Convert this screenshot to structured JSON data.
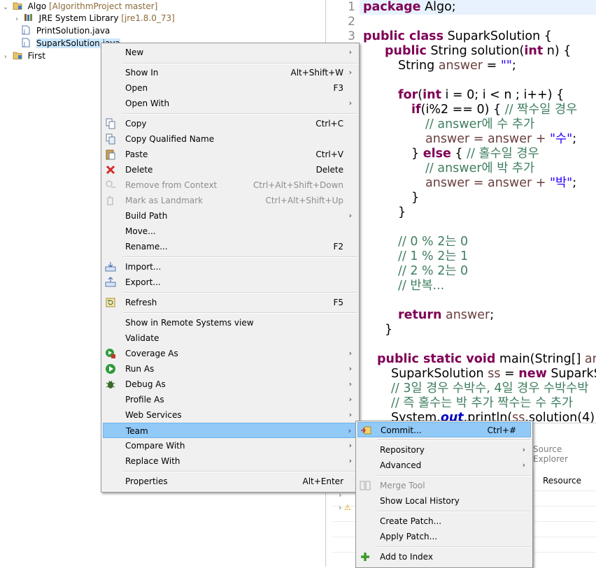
{
  "explorer": {
    "rows": [
      {
        "label": "Algo",
        "decoration": "[AlgorithmProject master]"
      },
      {
        "label": "JRE System Library",
        "decoration": "[jre1.8.0_73]"
      },
      {
        "label": "PrintSolution.java"
      },
      {
        "label": "SuparkSolution.java"
      },
      {
        "label": "First"
      }
    ]
  },
  "editor": {
    "line_numbers": [
      "1",
      "2",
      "3"
    ],
    "lines": {
      "l1_kw": "package",
      "l1_rest": " Algo;",
      "l3_kw": "public class",
      "l3_rest": " SuparkSolution {",
      "l4_kw": "public",
      "l4_a": " String solution(",
      "l4_kw2": "int",
      "l4_b": " n) {",
      "l5_a": "String ",
      "l5_var": "answer",
      "l5_b": " = ",
      "l5_str": "\"\"",
      "l5_c": ";",
      "l7_kw": "for",
      "l7_a": "(",
      "l7_kw2": "int",
      "l7_b": " i = 0; i < n ; i++) {",
      "l8_kw": "if",
      "l8_a": "(i%2 == 0) { ",
      "l8_cm": "// 짝수일 경우",
      "l9_cm": "// answer에 수 추가",
      "l10_a": "answer = answer + ",
      "l10_str": "\"수\"",
      "l10_b": ";",
      "l11_a": "} ",
      "l11_kw": "else",
      "l11_b": " { ",
      "l11_cm": "// 홀수일 경우",
      "l12_cm": "// answer에 박 추가",
      "l13_a": "answer = answer + ",
      "l13_str": "\"박\"",
      "l13_b": ";",
      "l14": "}",
      "l15": "}",
      "l17_cm": "// 0 % 2는 0",
      "l18_cm": "// 1 % 2는 1",
      "l19_cm": "// 2 % 2는 0",
      "l20_cm": "// 반복...",
      "l22_kw": "return",
      "l22_var": " answer",
      "l22_b": ";",
      "l23": "}",
      "l25_kw": "public static void",
      "l25_a": " main(String[] ",
      "l25_var": "args",
      "l26_a": "SuparkSolution ",
      "l26_var": "ss",
      "l26_b": " = ",
      "l26_kw": "new",
      "l26_c": " SuparkS",
      "l27_cm": "// 3일 경우 수박수, 4일 경우 수박수박",
      "l28_cm": "// 즉 홀수는 박 추가 짝수는 수 추가",
      "l29_a": "System.",
      "l29_it": "out",
      "l29_b": ".println(",
      "l29_var": "ss",
      "l29_c": ".solution(4)"
    }
  },
  "bottom_panel": {
    "tab_source_explorer": "Source Explorer",
    "column_resource": "Resource"
  },
  "context_menu": {
    "items": [
      {
        "label": "New",
        "arrow": "›"
      },
      {
        "label": "Show In",
        "accel": "Alt+Shift+W",
        "arrow": "›"
      },
      {
        "label": "Open",
        "accel": "F3"
      },
      {
        "label": "Open With",
        "arrow": "›"
      },
      {
        "label": "Copy",
        "accel": "Ctrl+C",
        "icon": "copy-icon"
      },
      {
        "label": "Copy Qualified Name",
        "icon": "copy-qualified-icon"
      },
      {
        "label": "Paste",
        "accel": "Ctrl+V",
        "icon": "paste-icon"
      },
      {
        "label": "Delete",
        "accel": "Delete",
        "icon": "delete-icon"
      },
      {
        "label": "Remove from Context",
        "accel": "Ctrl+Alt+Shift+Down",
        "icon": "remove-context-icon",
        "disabled": true
      },
      {
        "label": "Mark as Landmark",
        "accel": "Ctrl+Alt+Shift+Up",
        "icon": "landmark-icon",
        "disabled": true
      },
      {
        "label": "Build Path",
        "arrow": "›"
      },
      {
        "label": "Move..."
      },
      {
        "label": "Rename...",
        "accel": "F2"
      },
      {
        "label": "Import...",
        "icon": "import-icon"
      },
      {
        "label": "Export...",
        "icon": "export-icon"
      },
      {
        "label": "Refresh",
        "accel": "F5",
        "icon": "refresh-icon"
      },
      {
        "label": "Show in Remote Systems view"
      },
      {
        "label": "Validate"
      },
      {
        "label": "Coverage As",
        "arrow": "›",
        "icon": "coverage-icon"
      },
      {
        "label": "Run As",
        "arrow": "›",
        "icon": "run-icon"
      },
      {
        "label": "Debug As",
        "arrow": "›",
        "icon": "debug-icon"
      },
      {
        "label": "Profile As",
        "arrow": "›"
      },
      {
        "label": "Web Services",
        "arrow": "›"
      },
      {
        "label": "Team",
        "arrow": "›"
      },
      {
        "label": "Compare With",
        "arrow": "›"
      },
      {
        "label": "Replace With",
        "arrow": "›"
      },
      {
        "label": "Properties",
        "accel": "Alt+Enter"
      }
    ]
  },
  "team_submenu": {
    "items": [
      {
        "label": "Commit...",
        "accel": "Ctrl+#",
        "icon": "commit-icon"
      },
      {
        "label": "Repository",
        "arrow": "›"
      },
      {
        "label": "Advanced",
        "arrow": "›"
      },
      {
        "label": "Merge Tool",
        "icon": "merge-tool-icon",
        "disabled": true
      },
      {
        "label": "Show Local History"
      },
      {
        "label": "Create Patch..."
      },
      {
        "label": "Apply Patch..."
      },
      {
        "label": "Add to Index",
        "icon": "add-index-icon"
      }
    ]
  },
  "colors": {
    "menu_highlight": "#91c9f7",
    "keyword": "#7f0055",
    "comment": "#3f7f5f",
    "string": "#2a00ff",
    "tree_selection": "#cce8ff"
  }
}
